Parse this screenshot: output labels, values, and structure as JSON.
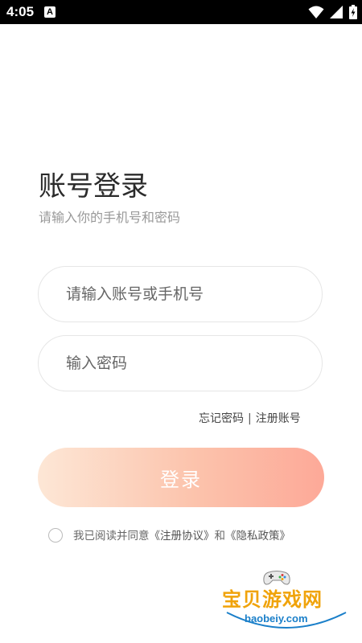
{
  "status_bar": {
    "time": "4:05",
    "app_icon_letter": "A",
    "icons": [
      "wifi-icon",
      "signal-icon",
      "battery-charging-icon"
    ]
  },
  "login": {
    "title": "账号登录",
    "subtitle": "请输入你的手机号和密码",
    "account_field": {
      "placeholder": "请输入账号或手机号",
      "value": ""
    },
    "password_field": {
      "placeholder": "输入密码",
      "value": ""
    },
    "forgot_password": "忘记密码",
    "separator": "|",
    "register": "注册账号",
    "login_button": "登录",
    "agreement": {
      "checked": false,
      "prefix": "我已阅读并同意",
      "user_agreement": "《注册协议》",
      "conjunction": "和",
      "privacy_policy": "《隐私政策》"
    }
  },
  "watermark": {
    "brand": "宝贝游戏网",
    "url": "baobeiy.com"
  },
  "colors": {
    "status_bar_bg": "#000000",
    "button_gradient_start": "#fde7d6",
    "button_gradient_end": "#fda998",
    "watermark_brand": "#f0a30a",
    "watermark_url": "#1a7fc9"
  }
}
